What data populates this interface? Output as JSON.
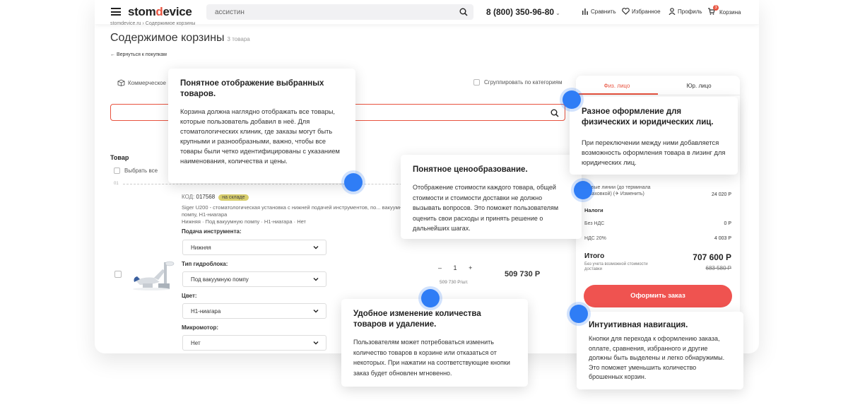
{
  "header": {
    "logo_left": "stom",
    "logo_mid": "d",
    "logo_right": "evice",
    "search_value": "ассистин",
    "phone": "8 (800) 350-96-80",
    "nav": {
      "compare": "Сравнить",
      "favorites": "Избранное",
      "profile": "Профиль",
      "cart": "Корзина",
      "cart_count": "3"
    }
  },
  "page": {
    "breadcrumb": "stomdevice.ru  ›  Содержимое корзины",
    "title": "Содержимое корзины",
    "title_count": "3 товара",
    "back_link": "Вернуться к покупкам",
    "business_label": "Коммерческое",
    "group_label": "Сгруппировать по категориям",
    "column_product": "Товар",
    "select_all": "Выбрать все",
    "separator_label": "01"
  },
  "product": {
    "code_label": "КОД:",
    "code": "017568",
    "stock": "на складе",
    "description": "Siger U200 - стоматологическая установка с нижней подачей инструментов, по... вакуумную помпу, Н1-ниагара",
    "description_line2": "Нижняя · Под вакуумную помпу · Н1-ниагара · Нет",
    "options": [
      {
        "label": "Подача инструмента:",
        "value": "Нижняя"
      },
      {
        "label": "Тип гидроблока:",
        "value": "Под вакуумную помпу"
      },
      {
        "label": "Цвет:",
        "value": "Н1-ниагара"
      },
      {
        "label": "Микромотор:",
        "value": "Нет"
      }
    ],
    "qty_minus": "–",
    "qty": "1",
    "qty_plus": "+",
    "unit_price": "509 730 Р/шт.",
    "total": "509 730 Р"
  },
  "summary": {
    "tab_individual": "Физ. лицо",
    "tab_legal": "Юр. лицо",
    "lines_label": "...овые линии (до терминала страховкой) (✈ Изменить)",
    "lines_value": "24 020 Р",
    "taxes_label": "Налоги",
    "no_vat_label": "Без НДС",
    "no_vat_value": "0 Р",
    "vat_label": "НДС 20%",
    "vat_value": "4 003 Р",
    "total_label": "Итого",
    "total_value": "707 600 Р",
    "total_sub": "Без учета возможной стоимости доставки",
    "total_old": "683 580 Р",
    "order_button": "Оформить заказ"
  },
  "callouts": {
    "c1": {
      "title": "Понятное отображение выбранных товаров.",
      "text": "Корзина должна наглядно отображать все товары, которые пользователь добавил в неё. Для стоматологических клиник, где заказы могут быть крупными и разнообразными, важно, чтобы все товары были четко идентифицированы с указанием наименования, количества и цены."
    },
    "c2": {
      "title": "Понятное ценообразование.",
      "text": "Отображение стоимости каждого товара, общей стоимости и стоимости доставки не должно вызывать вопросов. Это поможет пользователям оценить свои расходы и принять решение о дальнейших шагах."
    },
    "c3": {
      "title": "Разное оформление для физических и юридических лиц.",
      "text": "При переключении между ними добавляется возможность оформления товара в лизинг для юридических лиц."
    },
    "c4": {
      "title": "Удобное изменение количества товаров и удаление.",
      "text": "Пользователям может потребоваться изменить количество товаров в корзине или отказаться от некоторых. При нажатии на соответствующие кнопки заказ будет обновлен мгновенно."
    },
    "c5": {
      "title": "Интуитивная навигация.",
      "text": "Кнопки для перехода к оформлению заказа, оплате, сравнения, избранного и другие должны быть выделены и легко обнаружимы. Это поможет уменьшить количество брошенных корзин."
    }
  },
  "colors": {
    "accent": "#e8533f",
    "order_button": "#ef5350",
    "marker": "#2f7df6",
    "stock_badge": "#d9cf6e"
  }
}
